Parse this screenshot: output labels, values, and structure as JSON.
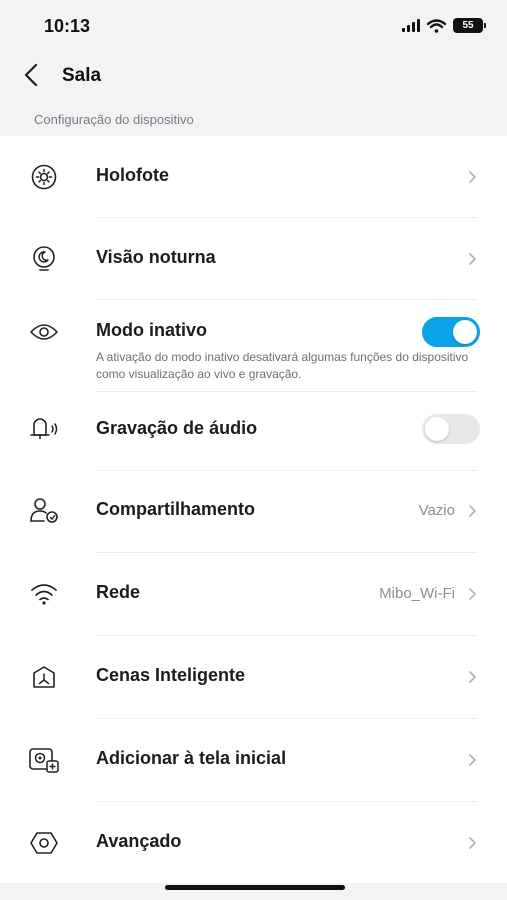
{
  "status_bar": {
    "time": "10:13",
    "battery": "55"
  },
  "nav": {
    "title": "Sala"
  },
  "section": {
    "header": "Configuração do dispositivo"
  },
  "rows": [
    {
      "label": "Holofote",
      "icon": "spotlight-icon"
    },
    {
      "label": "Visão noturna",
      "icon": "night-vision-icon"
    },
    {
      "label": "Modo inativo",
      "icon": "eye-icon",
      "description": "A ativação do modo inativo desativará algumas funções do dispositivo como visualização ao vivo e gravação.",
      "toggle": true
    },
    {
      "label": "Gravação de áudio",
      "icon": "audio-recording-icon",
      "toggle": false
    },
    {
      "label": "Compartilhamento",
      "icon": "share-users-icon",
      "value": "Vazio"
    },
    {
      "label": "Rede",
      "icon": "wifi-icon",
      "value": "Mibo_Wi-Fi"
    },
    {
      "label": "Cenas Inteligente",
      "icon": "smart-scenes-icon"
    },
    {
      "label": "Adicionar à tela inicial",
      "icon": "add-to-home-icon"
    },
    {
      "label": "Avançado",
      "icon": "advanced-icon"
    }
  ],
  "colors": {
    "accent": "#0aa2e8",
    "background": "#f3f3f5",
    "card": "#ffffff"
  }
}
